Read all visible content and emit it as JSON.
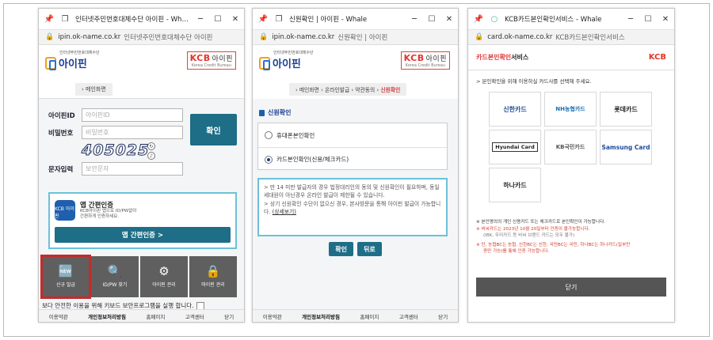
{
  "windows": [
    {
      "tab_title": "인터넷주민번호대체수단 아이핀 - Whale",
      "url": "ipin.ok-name.co.kr",
      "site_name": "인터넷주민번호대체수단 아이핀"
    },
    {
      "tab_title": "신원확인 | 아이핀 - Whale",
      "url": "ipin.ok-name.co.kr",
      "site_name": "신원확인 | 아이핀"
    },
    {
      "tab_title": "KCB카드본인확인서비스 - Whale",
      "url": "card.ok-name.co.kr",
      "site_name": "KCB카드본인확인서비스"
    }
  ],
  "titlebar": {
    "minimize": "─",
    "maximize": "☐",
    "close": "✕"
  },
  "ipin_logo": {
    "tagline": "인터넷주민번호대체수단",
    "name": "아이핀"
  },
  "kcb_logo": {
    "brand": "KCB",
    "suffix": "아이핀",
    "sub": "Korea Credit Bureau"
  },
  "login": {
    "breadcrumb": "메인화면",
    "id_label": "아이핀ID",
    "id_placeholder": "아이핀ID",
    "pw_label": "비밀번호",
    "pw_placeholder": "비밀번호",
    "confirm_button": "확인",
    "captcha_text": "405025",
    "captcha_input_label": "문자입력",
    "captcha_placeholder": "보안문자",
    "app_title": "앱 간편인증",
    "app_icon_label": "KCB 아이핀",
    "app_desc_1": "KCB아이핀 앱으로 ID/PW없이",
    "app_desc_2": "간편하게 인증하세요.",
    "app_button": "앱 간편인증 >",
    "menu": [
      {
        "icon": "🆕",
        "label": "신규 발급"
      },
      {
        "icon": "🔍",
        "label": "ID/PW 찾기"
      },
      {
        "icon": "⚙",
        "label": "아이핀 관리"
      },
      {
        "icon": "🔒",
        "label": "마이핀 관리"
      }
    ],
    "security_notice": "보다 안전한 이용을 위해 키보드 보안프로그램을 실행 합니다.",
    "footer": [
      "이용약관",
      "개인정보처리방침",
      "홈페이지",
      "고객센터",
      "닫기"
    ]
  },
  "identity": {
    "breadcrumb": [
      "메인화면",
      "온라인발급",
      "약관동의",
      "신원확인"
    ],
    "section_title": "신원확인",
    "options": [
      {
        "label": "휴대폰본인확인",
        "selected": false
      },
      {
        "label": "카드본인확인(신용/체크카드)",
        "selected": true
      }
    ],
    "info_1": "> 만 14 미만 발급자의 경우 법정대리인의 동의 및 신원확인이 필요하며, 동일 세대원이 아닌경우 온라인 발급이 제한될 수 있습니다.",
    "info_2": "> 상기 신원확인 수단이 없으신 경우, 본사방문을 통해 아이핀 발급이 가능합니다.",
    "info_link": "(상세보기)",
    "confirm_button": "확인",
    "back_button": "뒤로",
    "footer": [
      "이용약관",
      "개인정보처리방침",
      "홈페이지",
      "고객센터",
      "닫기"
    ]
  },
  "card": {
    "header_title_red": "카드본인확인",
    "header_title_dark": "서비스",
    "header_logo": "KCB",
    "description": "> 본인확인을 위해 이용하실 카드사를 선택해 주세요.",
    "cards": [
      "신한카드",
      "NH농협카드",
      "롯데카드",
      "Hyundai Card",
      "KB국민카드",
      "Samsung Card",
      "하나카드"
    ],
    "notes": [
      "※ 본인명의의 개인 신용카드 또는 체크카드로 본인확인이 가능합니다.",
      "※ 비씨카드는 2023년 10월 20일부터 인증이 불가능합니다.",
      "(IBK, 우리카드 등 비씨 브랜드 카드는 모두 불가)",
      "※ 단, 농협BC는 농협, 신한BC는 신한, 국민BC는 국민, 하나BC는 하나카드(일부만",
      "증만 가능)를 통해 인증 가능합니다."
    ],
    "close_button": "닫기"
  },
  "colors": {
    "teal": "#1d6e86",
    "kcb_red": "#e0362a",
    "ipin_blue": "#1a3f8f",
    "highlight": "#c42b2b"
  }
}
